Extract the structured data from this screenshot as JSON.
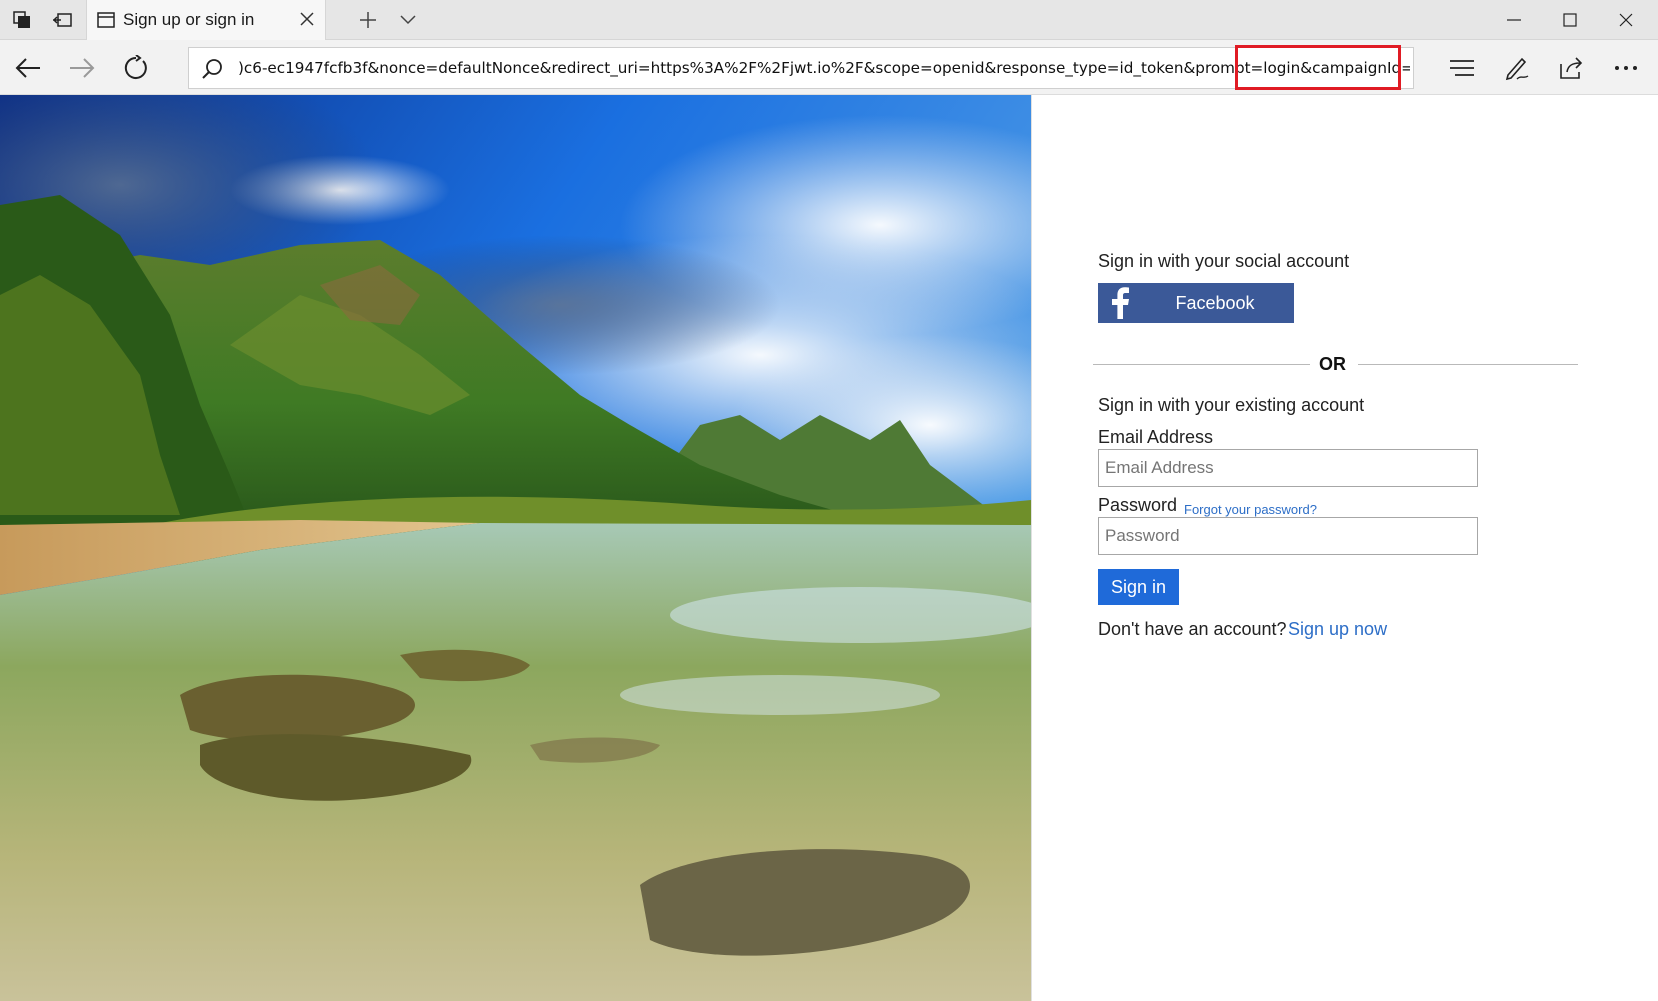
{
  "browser": {
    "tab": {
      "title": "Sign up or sign in"
    },
    "address_bar": {
      "url": ")c6-ec1947fcfb3f&nonce=defaultNonce&redirect_uri=https%3A%2F%2Fjwt.io%2F&scope=openid&response_type=id_token&prompt=login&campaignId=hawaii",
      "highlighted_param": "&campaignId=hawaii"
    }
  },
  "page": {
    "social": {
      "heading": "Sign in with your social account",
      "facebook_label": "Facebook"
    },
    "divider_text": "OR",
    "local": {
      "heading": "Sign in with your existing account",
      "email_label": "Email Address",
      "email_placeholder": "Email Address",
      "email_value": "",
      "password_label": "Password",
      "password_placeholder": "Password",
      "password_value": "",
      "forgot_link": "Forgot your password?",
      "signin_button": "Sign in",
      "no_account_text": "Don't have an account?",
      "signup_link": "Sign up now"
    }
  },
  "colors": {
    "facebook": "#3b5998",
    "primary_button": "#1f6ad9",
    "link": "#2d6ec7",
    "highlight_box": "#e01b24"
  }
}
